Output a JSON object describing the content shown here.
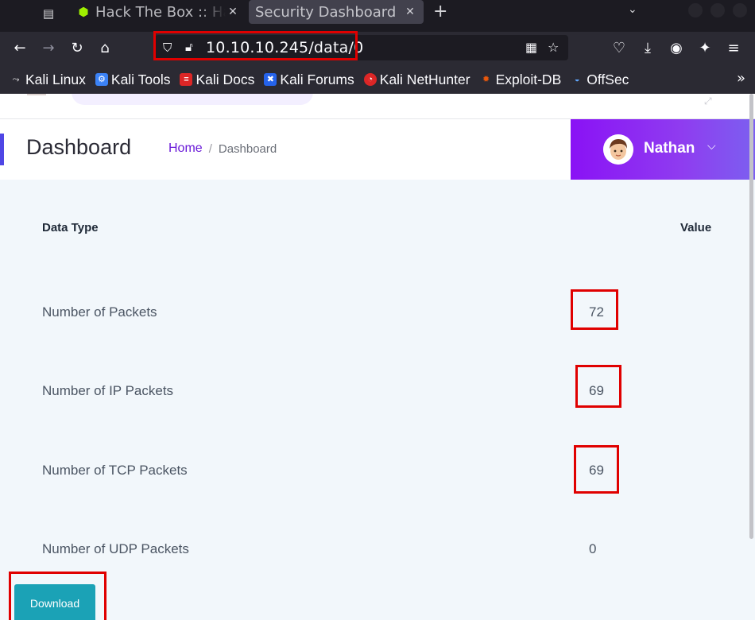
{
  "browser": {
    "tabs": [
      {
        "title": "Hack The Box :: Hack The Box",
        "active": false,
        "icon": "htb-cube-icon"
      },
      {
        "title": "Security Dashboard",
        "active": true
      }
    ],
    "url": "10.10.10.245/data/0",
    "bookmarks": [
      {
        "label": "Kali Linux",
        "icon": "kali-dragon-icon",
        "color": "#ffffff"
      },
      {
        "label": "Kali Tools",
        "icon": "kali-tools-icon",
        "color": "#3b82f6"
      },
      {
        "label": "Kali Docs",
        "icon": "kali-docs-icon",
        "color": "#dc2626"
      },
      {
        "label": "Kali Forums",
        "icon": "kali-forums-icon",
        "color": "#2563eb"
      },
      {
        "label": "Kali NetHunter",
        "icon": "nethunter-icon",
        "color": "#dc2626"
      },
      {
        "label": "Exploit-DB",
        "icon": "exploitdb-icon",
        "color": "#ea580c"
      },
      {
        "label": "OffSec",
        "icon": "offsec-icon",
        "color": "#3b82f6"
      }
    ]
  },
  "header": {
    "title": "Dashboard",
    "breadcrumb": {
      "home": "Home",
      "separator": "/",
      "current": "Dashboard"
    },
    "user": {
      "name": "Nathan"
    },
    "accent_color": "#8a12f5"
  },
  "table": {
    "headers": {
      "type": "Data Type",
      "value": "Value"
    },
    "rows": [
      {
        "label": "Number of Packets",
        "value": "72",
        "highlighted": true
      },
      {
        "label": "Number of IP Packets",
        "value": "69",
        "highlighted": true
      },
      {
        "label": "Number of TCP Packets",
        "value": "69",
        "highlighted": true
      },
      {
        "label": "Number of UDP Packets",
        "value": "0",
        "highlighted": false
      }
    ]
  },
  "actions": {
    "download_label": "Download",
    "download_color": "#1ba2b6"
  },
  "annotation_color": "#e00000"
}
